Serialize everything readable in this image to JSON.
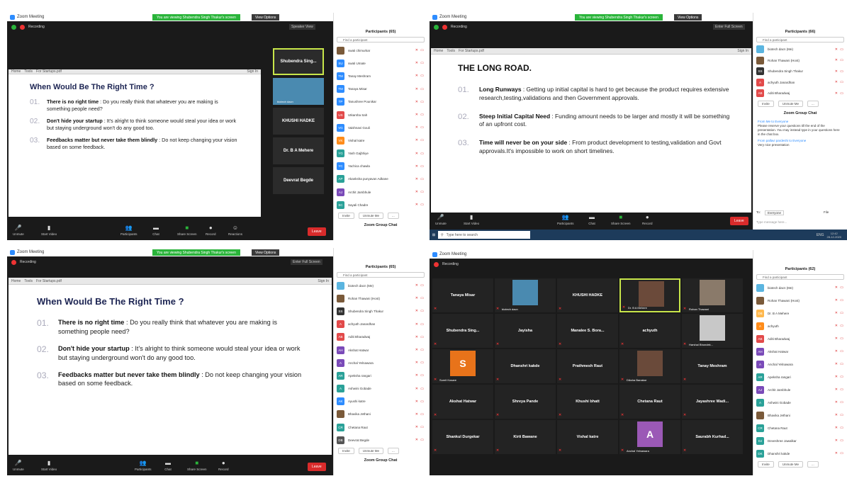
{
  "app": {
    "title": "Zoom Meeting",
    "viewing": "You are viewing Shubendra Singh Thakur's screen",
    "view_options": "View Options",
    "recording": "Recording",
    "speaker_view": "Speaker View",
    "exit_fullscreen": "Enter Full Screen",
    "file_tab": "For Startups.pdf",
    "menu_home": "Home",
    "menu_tools": "Tools",
    "sign_in": "Sign In",
    "doc_title": "For Startups.pdf"
  },
  "toolbar": {
    "unmute": "Unmute",
    "start_video": "Start Video",
    "participants": "Participants",
    "chat": "Chat",
    "share": "Share Screen",
    "record": "Record",
    "reactions": "Reactions",
    "leave": "Leave",
    "count": "65"
  },
  "slide1": {
    "title": "When Would Be The Right Time ?",
    "items": [
      {
        "num": "01.",
        "bold": "There is no right time",
        "rest": " : Do you really think that whatever you are making is something people need?"
      },
      {
        "num": "02.",
        "bold": "Don't hide your startup",
        "rest": " : It's alright to think someone would steal your idea or work but staying underground won't do any good too."
      },
      {
        "num": "03.",
        "bold": "Feedbacks matter but never take them blindly",
        "rest": " : Do not keep changing your vision based on some feedback."
      }
    ]
  },
  "slide2": {
    "title": "THE LONG ROAD.",
    "items": [
      {
        "num": "01.",
        "bold": "Long Runways",
        "rest": " : Getting up initial capital is hard to get because the product requires extensive research,testing,validations and then Government approvals."
      },
      {
        "num": "02.",
        "bold": "Steep Initial Capital Need",
        "rest": " : Funding amount needs to be larger and mostly it will be something of an upfront cost."
      },
      {
        "num": "03.",
        "bold": "Time will never be on your side",
        "rest": " : From product development to testing,validation and Govt approvals.It's impossible to work on short timelines."
      }
    ]
  },
  "q1_side": [
    "Shubendra Sing...",
    "biotech dacn",
    "KHUSHI HADKE",
    "Dr. B A Mehere",
    "Deevrat Begde"
  ],
  "panel1": {
    "title": "Participants (65)",
    "find": "Find a participant",
    "rows": [
      {
        "name": "swati chimurkar",
        "c": "#7a5a3a",
        "i": ""
      },
      {
        "name": "swati Umate",
        "c": "#2d8cff",
        "i": "SU"
      },
      {
        "name": "Tanay Meshram",
        "c": "#2d8cff",
        "i": "TM"
      },
      {
        "name": "Tanaya Misar",
        "c": "#2d8cff",
        "i": "TM"
      },
      {
        "name": "Tanushree Pounikar",
        "c": "#2d8cff",
        "i": "TP"
      },
      {
        "name": "Utkarsha Sah",
        "c": "#e24a4a",
        "i": "US"
      },
      {
        "name": "Vaishnavi Gouli",
        "c": "#2d8cff",
        "i": "VG"
      },
      {
        "name": "Vishal katre",
        "c": "#ff8c1a",
        "i": "VK"
      },
      {
        "name": "Yash Gajbhiye",
        "c": "#2aa198",
        "i": "YG"
      },
      {
        "name": "Yachica chawla",
        "c": "#2d8cff",
        "i": "YC"
      },
      {
        "name": "Akanksha punyavan Adkane",
        "c": "#2aa198",
        "i": "AP"
      },
      {
        "name": "Archit Jambhule",
        "c": "#7a4ab8",
        "i": "AJ"
      },
      {
        "name": "Sayali Chadre",
        "c": "#2aa198",
        "i": "SC"
      }
    ],
    "invite": "Invite",
    "unmute_me": "Unmute Me",
    "more": "...",
    "chat": "Zoom Group Chat"
  },
  "panel2": {
    "title": "Participants (66)",
    "find": "Find a participant",
    "rows": [
      {
        "name": "biotech dacn (Me)",
        "c": "#5bb5e0",
        "i": ""
      },
      {
        "name": "Rohan Thawani (Host)",
        "c": "#7a5a3a",
        "i": ""
      },
      {
        "name": "Shubendra Singh Thakur",
        "c": "#333",
        "i": "SS"
      },
      {
        "name": "achyuth Janardhan",
        "c": "#e24a4a",
        "i": "A"
      },
      {
        "name": "Aditi Bharadwaj",
        "c": "#e24a4a",
        "i": "AB"
      }
    ],
    "invite": "Invite",
    "unmute_me": "Unmute Me",
    "more": "...",
    "chat": "Zoom Group Chat",
    "chat_from": "From Me to Everyone",
    "chat_msg": "Please reserve your questions till the end of the presentation. You may instead type in your questions here in the chat box.",
    "chat_from2": "From pallavi pardeshi to Everyone",
    "chat_msg2": "Very nice  presentation",
    "to": "To:",
    "everyone": "Everyone",
    "file": "File",
    "type_msg": "Type message here..."
  },
  "panel3": {
    "title": "Participants (65)",
    "find": "Find a participant",
    "rows": [
      {
        "name": "biotech dacn (Me)",
        "c": "#5bb5e0",
        "i": ""
      },
      {
        "name": "Rohan Thawani (Host)",
        "c": "#7a5a3a",
        "i": ""
      },
      {
        "name": "Shubendra Singh Thakur",
        "c": "#333",
        "i": "SS"
      },
      {
        "name": "achyuth Janardhan",
        "c": "#e24a4a",
        "i": "A"
      },
      {
        "name": "Aditi Bharadwaj",
        "c": "#e24a4a",
        "i": "AB"
      },
      {
        "name": "Akshat Hatwar",
        "c": "#7a4ab8",
        "i": "AH"
      },
      {
        "name": "Anchal Yelnawara",
        "c": "#7a4ab8",
        "i": "A"
      },
      {
        "name": "Apeksha rangari",
        "c": "#2aa198",
        "i": "AR"
      },
      {
        "name": "Ashwini Gobade",
        "c": "#2aa198",
        "i": "A"
      },
      {
        "name": "Ayushi katre",
        "c": "#2d8cff",
        "i": "AK"
      },
      {
        "name": "Bhavika Jethani",
        "c": "#7a5a3a",
        "i": ""
      },
      {
        "name": "Chetana Raut",
        "c": "#2aa198",
        "i": "CR"
      },
      {
        "name": "Deevrat Begde",
        "c": "#555",
        "i": "DB"
      }
    ],
    "invite": "Invite",
    "unmute_me": "Unmute Me",
    "more": "...",
    "chat": "Zoom Group Chat"
  },
  "panel4": {
    "title": "Participants (62)",
    "find": "Find a participant",
    "rows": [
      {
        "name": "biotech dacn (Me)",
        "c": "#5bb5e0",
        "i": ""
      },
      {
        "name": "Rohan Thawani (Host)",
        "c": "#7a5a3a",
        "i": ""
      },
      {
        "name": "Dr. B A Mehere",
        "c": "#ffb84d",
        "i": "DB"
      },
      {
        "name": "achyuth",
        "c": "#ff8c1a",
        "i": "A"
      },
      {
        "name": "Aditi Bharadwaj",
        "c": "#e24a4a",
        "i": "AB"
      },
      {
        "name": "Akshat Hatwar",
        "c": "#7a4ab8",
        "i": "AH"
      },
      {
        "name": "Anchal Yelnawara",
        "c": "#7a4ab8",
        "i": "A"
      },
      {
        "name": "Apeksha rangari",
        "c": "#2aa198",
        "i": "AR"
      },
      {
        "name": "Archit Jambhule",
        "c": "#7a4ab8",
        "i": "AJ"
      },
      {
        "name": "Ashwini Gobade",
        "c": "#2aa198",
        "i": "A"
      },
      {
        "name": "Bhavika Jethani",
        "c": "#7a5a3a",
        "i": ""
      },
      {
        "name": "Chetana Raut",
        "c": "#2aa198",
        "i": "CR"
      },
      {
        "name": "Deveshree Jawalkar",
        "c": "#2aa198",
        "i": "DJ"
      },
      {
        "name": "Dhanshri kakde",
        "c": "#2aa198",
        "i": "DK"
      }
    ],
    "invite": "Invite",
    "unmute_me": "Unmute Me",
    "more": "..."
  },
  "gallery": [
    "Tanaya Misar",
    "biotech dacn",
    "KHUSHI HADKE",
    "Dr. B A Mehere",
    "Rohan Thawani",
    "Shubendra Sing...",
    "Jayisha",
    "Manalee S. Bora...",
    "achyuth",
    "Harshal Bhondek...",
    "Sumit Kosare",
    "Dhanshri kakde",
    "Prathmesh Raut",
    "Diksha Banakar",
    "Tanay Meshram",
    "Akshat Hatwar",
    "Shreya Pande",
    "Khushi bhatt",
    "Chetana Raut",
    "Jayashree Wadi...",
    "Shankul Durgekar",
    "Kirti Bawane",
    "Vishal katre",
    "Anchal Yelnawara",
    "Saurabh Kurhad..."
  ],
  "taskbar": {
    "search": "Type here to search",
    "time": "12:42",
    "date": "28-12-2020",
    "lang": "ENG"
  }
}
